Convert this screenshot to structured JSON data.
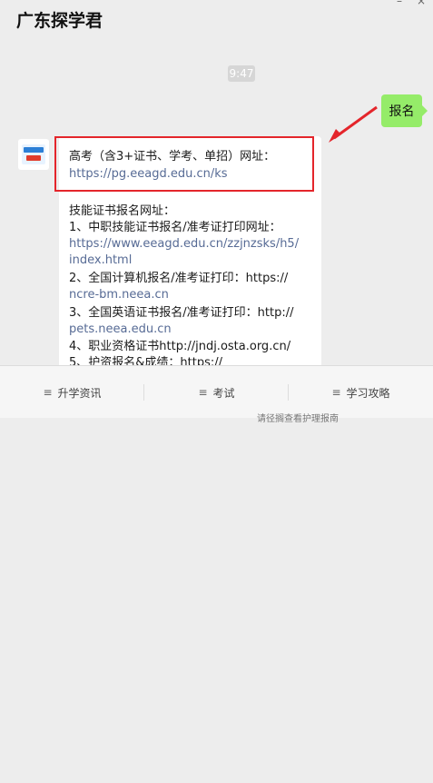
{
  "header": {
    "title": "广东探学君"
  },
  "top_icons": [
    {
      "name": "minimize-icon",
      "glyph": "–"
    },
    {
      "name": "close-icon",
      "glyph": "×"
    }
  ],
  "chat": {
    "time": "9:47",
    "user_message": "报名",
    "bot_message": {
      "lines": [
        "高考（含3+证书、学考、单招）网址：",
        "https://pg.eeagd.edu.cn/ks",
        "技能证书报名网址：",
        "1、中职技能证书报名/准考证打印网址：",
        "https://www.eeagd.edu.cn/zzjnzsks/h5/",
        "index.html",
        "2、全国计算机报名/准考证打印：https://",
        "ncre-bm.neea.cn",
        "3、全国英语证书报名/准考证打印：http://",
        "pets.neea.edu.cn",
        "4、职业资格证书http://jndj.osta.org.cn/",
        "5、护资报名&成绩：https://"
      ]
    }
  },
  "bottom_tabs": [
    {
      "label": "升学资讯"
    },
    {
      "label": "考试"
    },
    {
      "label": "学习攻略"
    }
  ],
  "footer_hint": "请径搁查看护理报南",
  "colors": {
    "highlight": "#e4252b",
    "arrow": "#e4252b",
    "link": "#576b95",
    "user_bubble": "#95ec69"
  }
}
